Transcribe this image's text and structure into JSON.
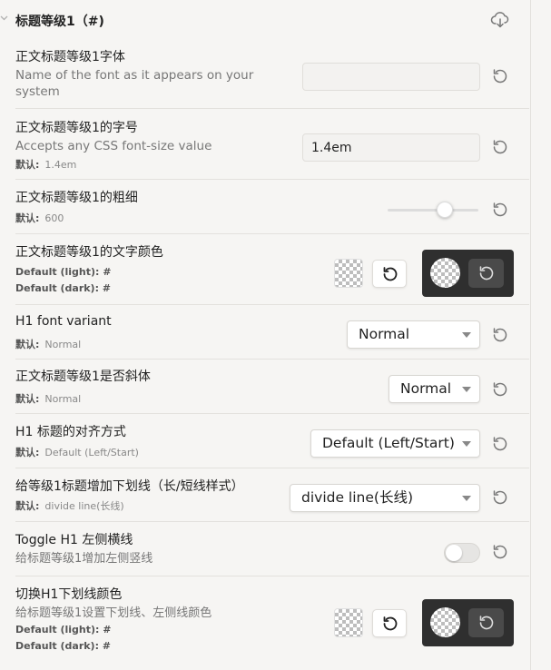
{
  "section": {
    "title": "标题等级1（#)",
    "collapse_icon": "chevron-down-icon",
    "download_icon": "download-cloud-icon"
  },
  "reset_icon": "reset-icon",
  "rows": [
    {
      "title": "正文标题等级1字体",
      "desc": "Name of the font as it appears on your system",
      "value": "",
      "placeholder": ""
    },
    {
      "title": "正文标题等级1的字号",
      "desc": "Accepts any CSS font-size value",
      "default_label": "默认:",
      "default_value": "1.4em",
      "value": "1.4em"
    },
    {
      "title": "正文标题等级1的粗细",
      "default_label": "默认:",
      "default_value": "600",
      "slider_value": 600,
      "slider_min": 100,
      "slider_max": 900
    },
    {
      "title": "正文标题等级1的文字颜色",
      "default_light": "Default (light): #",
      "default_dark": "Default (dark): #"
    },
    {
      "title": "H1 font variant",
      "default_label": "默认:",
      "default_value": "Normal",
      "selected": "Normal"
    },
    {
      "title": "正文标题等级1是否斜体",
      "default_label": "默认:",
      "default_value": "Normal",
      "selected": "Normal"
    },
    {
      "title": "H1 标题的对齐方式",
      "default_label": "默认:",
      "default_value": "Default (Left/Start)",
      "selected": "Default (Left/Start)"
    },
    {
      "title": "给等级1标题增加下划线（长/短线样式）",
      "default_label": "默认:",
      "default_value": "divide line(长线)",
      "selected": "divide line(长线)"
    },
    {
      "title": "Toggle H1 左侧横线",
      "desc": "给标题等级1增加左侧竖线",
      "toggle_on": false
    },
    {
      "title": "切换H1下划线颜色",
      "desc": "给标题等级1设置下划线、左侧线颜色",
      "default_light": "Default (light): #",
      "default_dark": "Default (dark): #"
    }
  ],
  "colors": {
    "background": "#f6f5f3",
    "dark_panel": "#2f2f2f",
    "divider": "#e3e1dd"
  }
}
